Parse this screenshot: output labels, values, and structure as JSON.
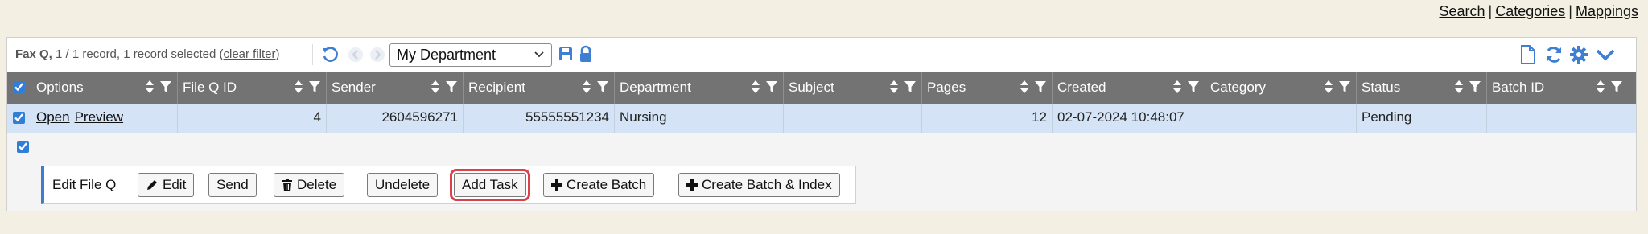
{
  "top_links": [
    "Search",
    "Categories",
    "Mappings"
  ],
  "toolbar": {
    "title": "Fax Q,",
    "record_info": "1 / 1 record, 1 record selected",
    "clear_filter": "clear filter",
    "department_select": "My Department"
  },
  "columns": [
    "Options",
    "File Q ID",
    "Sender",
    "Recipient",
    "Department",
    "Subject",
    "Pages",
    "Created",
    "Category",
    "Status",
    "Batch ID"
  ],
  "row": {
    "open": "Open",
    "preview": "Preview",
    "file_q_id": "4",
    "sender": "2604596271",
    "recipient": "55555551234",
    "department": "Nursing",
    "subject": "",
    "pages": "12",
    "created": "02-07-2024 10:48:07",
    "category": "",
    "status": "Pending",
    "batch_id": ""
  },
  "edit_panel": {
    "label": "Edit File Q",
    "buttons": {
      "edit": "Edit",
      "send": "Send",
      "delete": "Delete",
      "undelete": "Undelete",
      "add_task": "Add Task",
      "create_batch": "Create Batch",
      "create_batch_index": "Create Batch & Index"
    }
  },
  "colors": {
    "header_bg": "#737373",
    "row_bg": "#d4e3f5",
    "icon_blue": "#3f7fd1",
    "highlight": "#d9424a"
  }
}
